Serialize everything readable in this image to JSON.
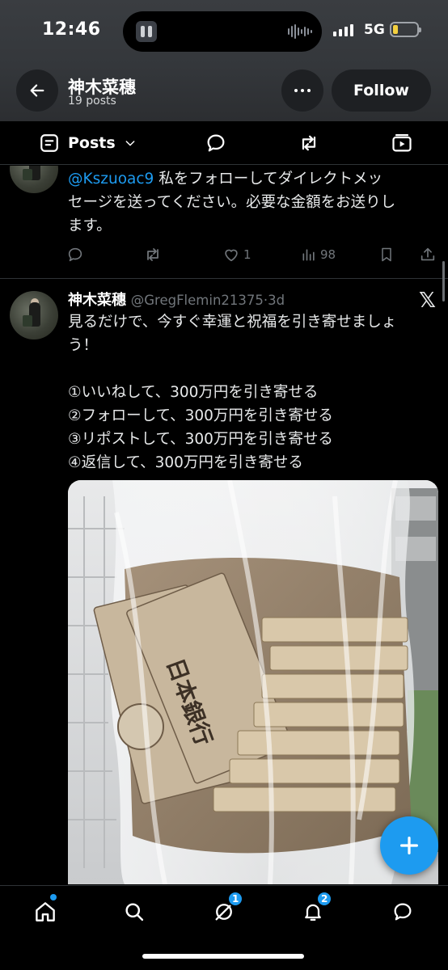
{
  "status_bar": {
    "time": "12:46",
    "network": "5G",
    "battery_fraction": 0.2,
    "battery_color": "#f4d03f"
  },
  "header": {
    "title": "神木菜穗",
    "subtitle": "19 posts",
    "follow_label": "Follow",
    "back_icon": "arrow-left-icon",
    "more_icon": "more-horizontal-icon"
  },
  "tabs": {
    "active": {
      "label": "Posts",
      "icon": "posts-icon"
    },
    "others": [
      "replies-icon",
      "reposts-icon",
      "media-icon"
    ]
  },
  "posts": [
    {
      "mention": "@Kszuoac9",
      "line1_rest": " 私をフォローしてダイレクトメッ",
      "line2": "セージを送ってください。必要な金額をお送りし",
      "line3": "ます。",
      "stats": {
        "replies": "",
        "reposts": "",
        "likes": "1",
        "views": "98"
      }
    },
    {
      "author": "神木菜穗",
      "handle": "@GregFlemin21375",
      "separator": "·",
      "age": "3d",
      "platform_logo": "𝕏",
      "lines": [
        "見るだけで、今すぐ幸運と祝福を引き寄せましょ",
        "う！",
        "",
        "①いいねして、300万円を引き寄せる",
        "②フォローして、300万円を引き寄せる",
        "③リポストして、300万円を引き寄せる",
        "④返信して、300万円を引き寄せる"
      ],
      "image_alt": "money-bag-photo"
    }
  ],
  "fab": {
    "icon": "plus-icon"
  },
  "bottom_nav": {
    "items": [
      "home-icon",
      "search-icon",
      "grok-icon",
      "notifications-icon",
      "messages-icon"
    ],
    "grok_badge": "1",
    "notifications_badge": "2"
  },
  "colors": {
    "accent": "#1d9bf0",
    "text": "#e7e9ea",
    "muted": "#71767b",
    "header_bg": "#36393d"
  }
}
